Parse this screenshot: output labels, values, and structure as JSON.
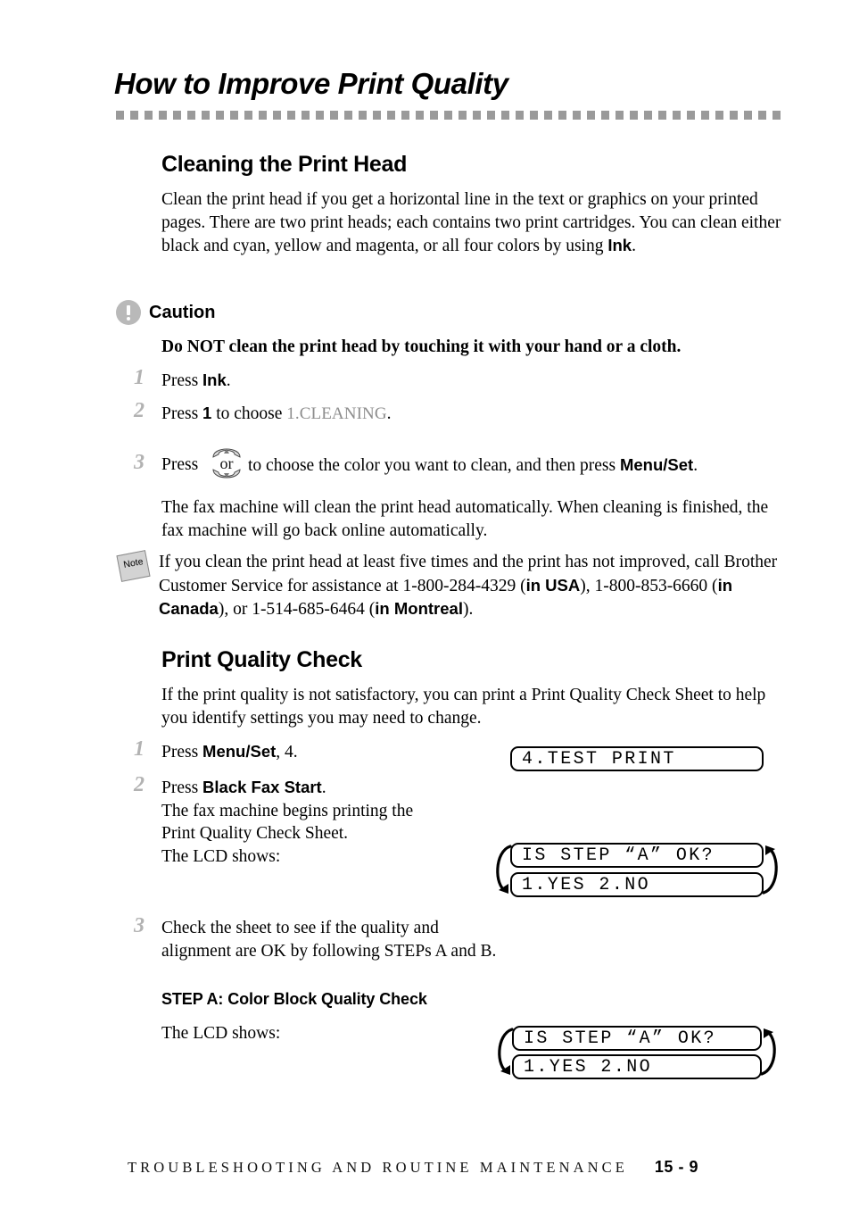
{
  "header": {
    "title": "How to Improve Print Quality",
    "rule_color": "#9a9a9a"
  },
  "sections": {
    "cleaning": {
      "heading": "Cleaning the Print Head",
      "intro_line1": "Clean the print head if you get a horizontal line in the text or graphics on your",
      "intro_line2": "printed pages. There are two print heads; each contains two print cartridges. You",
      "intro_line3": "can clean either black and cyan, yellow and magenta, or all four colors by using",
      "intro_bold": "Ink",
      "intro_end": ".",
      "caution_label": "Caution",
      "caution_icon": "exclamation-circle-icon",
      "caution_text": "Do NOT clean the print head by touching it with your hand or a cloth.",
      "steps": [
        {
          "number": "1",
          "pre": "Press ",
          "bold": "Ink",
          "post": "."
        },
        {
          "number": "2",
          "pre": "Press ",
          "bold": "1",
          "mid": " to choose ",
          "lcd": "1.CLEANING",
          "post": "."
        },
        {
          "number": "3",
          "pre": "Press ",
          "icon": "up-down-key-icon",
          "icon_label": "or",
          "mid": " to choose the color you want to clean, and then press ",
          "bold": "Menu/Set",
          "post": "."
        }
      ],
      "after_step3_line1": "The fax machine will clean the print head automatically. When cleaning is",
      "after_step3_line2": "finished, the fax machine will go back online automatically.",
      "note_icon": "note-tag-icon",
      "note_label": "Note",
      "note_line1": "If you clean the print head at least five times and the print has not improved, call",
      "note_line2_a": "Brother Customer Service for assistance at 1-800-284-4329 (",
      "note_line2_b": "in USA",
      "note_line2_c": "),",
      "note_line3_a": "1-800-853-6660 (",
      "note_line3_b": "in Canada",
      "note_line3_c": "), or 1-514-685-6464 (",
      "note_line3_d": "in Montreal",
      "note_line3_e": ")."
    },
    "quality_check": {
      "heading": "Print Quality Check",
      "intro_line1": "If the print quality is not satisfactory, you can print a Print Quality Check Sheet",
      "intro_line2": "to help you identify settings you may need to change.",
      "steps": [
        {
          "number": "1",
          "pre": "Press ",
          "bold": "Menu/Set",
          "post": ", 4."
        },
        {
          "number": "2",
          "pre": "Press ",
          "bold": "Black Fax Start",
          "post": ".",
          "line2": "The fax machine begins printing the",
          "line3": "Print Quality Check Sheet.",
          "line4": "The LCD shows:"
        },
        {
          "number": "3",
          "line1": "Check the sheet to see if the quality and",
          "line2": "alignment are OK by following STEPs A and B."
        }
      ],
      "lcd_test_print": "4.TEST PRINT",
      "lcd_step_a_line1": "IS STEP “A” OK?",
      "lcd_step_a_line2": "1.YES 2.NO"
    },
    "step_a": {
      "heading": "STEP A: Color Block Quality Check",
      "lcd_shows_label": "The LCD shows:",
      "lcd_line1": "IS STEP “A” OK?",
      "lcd_line2": "1.YES 2.NO"
    }
  },
  "footer": {
    "title": "TROUBLESHOOTING AND ROUTINE MAINTENANCE",
    "page": "15 - 9"
  }
}
